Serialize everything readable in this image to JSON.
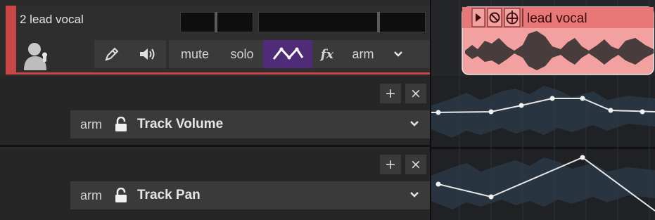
{
  "track": {
    "name": "2 lead vocal",
    "buttons": {
      "mute": "mute",
      "solo": "solo",
      "fx": "fx",
      "arm": "arm"
    },
    "accent_color": "#c94646",
    "active_button_color": "#4f2b78"
  },
  "lanes": [
    {
      "arm": "arm",
      "name": "Track Volume",
      "add": "+",
      "close": "×"
    },
    {
      "arm": "arm",
      "name": "Track Pan",
      "add": "+",
      "close": "×"
    }
  ],
  "item": {
    "name": "lead vocal",
    "color": "#f3a0a0"
  }
}
